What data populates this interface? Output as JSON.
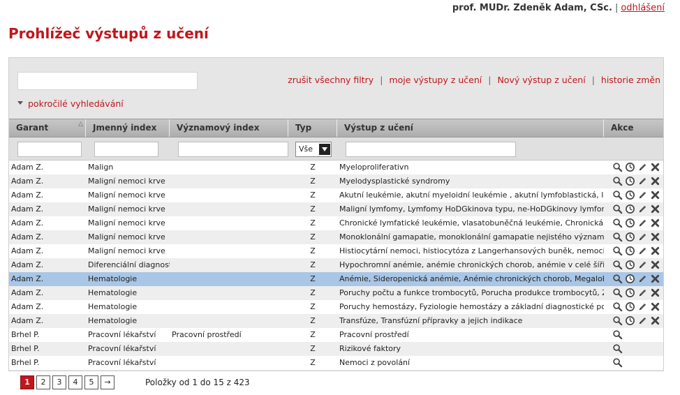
{
  "header": {
    "user_name": "prof. MUDr. Zdeněk Adam, CSc.",
    "separator": "|",
    "logout_label": "odhlášení"
  },
  "page": {
    "title": "Prohlížeč výstupů z učení"
  },
  "toolbar": {
    "search_value": "",
    "links": [
      "zrušit všechny filtry",
      "moje výstupy z učení",
      "Nový výstup z učení",
      "historie změn"
    ],
    "link_separator": "|",
    "advanced_search": "pokročilé vyhledávání"
  },
  "table": {
    "columns": [
      "Garant",
      "Jmenný index",
      "Významový index",
      "Typ",
      "Výstup z učení",
      "Akce"
    ],
    "sorted_column": "Garant",
    "type_filter": "Vše",
    "rows": [
      {
        "garant": "Adam Z.",
        "jmenny": "Malign",
        "vyznamovy": "",
        "typ": "Z",
        "vystup": "Myeloproliferativn",
        "actions": [
          "search",
          "history",
          "edit",
          "delete"
        ],
        "selected": false
      },
      {
        "garant": "Adam Z.",
        "jmenny": "Maligní nemoci krve",
        "vyznamovy": "",
        "typ": "Z",
        "vystup": "Myelodysplastické syndromy",
        "actions": [
          "search",
          "history",
          "edit",
          "delete"
        ],
        "selected": false
      },
      {
        "garant": "Adam Z.",
        "jmenny": "Maligní nemoci krve",
        "vyznamovy": "",
        "typ": "Z",
        "vystup": "Akutní leukémie, akutní myeloidní leukémie , akutní lymfoblastická, leukémie",
        "actions": [
          "search",
          "history",
          "edit",
          "delete"
        ],
        "selected": false
      },
      {
        "garant": "Adam Z.",
        "jmenny": "Maligní nemoci krve",
        "vyznamovy": "",
        "typ": "Z",
        "vystup": "Maligní lymfomy, Lymfomy HoDGkinova typu, ne-HoDGkinovy lymfomy",
        "actions": [
          "search",
          "history",
          "edit",
          "delete"
        ],
        "selected": false
      },
      {
        "garant": "Adam Z.",
        "jmenny": "Maligní nemoci krve",
        "vyznamovy": "",
        "typ": "Z",
        "vystup": "Chronické lymfatické leukémie, vlasatobuněčná leukémie, Chronická B-lymfocytární",
        "actions": [
          "search",
          "history",
          "edit",
          "delete"
        ],
        "selected": false
      },
      {
        "garant": "Adam Z.",
        "jmenny": "Maligní nemoci krve",
        "vyznamovy": "",
        "typ": "Z",
        "vystup": "Monoklonální gamapatie, monoklonální gamapatie nejistého významu (MGUS), myelom",
        "actions": [
          "search",
          "history",
          "edit",
          "delete"
        ],
        "selected": false
      },
      {
        "garant": "Adam Z.",
        "jmenny": "Maligní nemoci krve",
        "vyznamovy": "",
        "typ": "Z",
        "vystup": "Histiocytární nemoci, histiocytóza z Langerhansových buněk, nemoci ze skupiny",
        "actions": [
          "search",
          "history",
          "edit",
          "delete"
        ],
        "selected": false
      },
      {
        "garant": "Adam Z.",
        "jmenny": "Diferenciální diagnostiky",
        "vyznamovy": "",
        "typ": "Z",
        "vystup": "Hypochromní anémie, anémie chronických chorob, anémie v celé šíři, trombocytopenie",
        "actions": [
          "search",
          "history",
          "edit",
          "delete"
        ],
        "selected": false
      },
      {
        "garant": "Adam Z.",
        "jmenny": "Hematologie",
        "vyznamovy": "",
        "typ": "Z",
        "vystup": "Anémie, Sideropenická anémie, Anémie chronických chorob, Megaloblastové anémie",
        "actions": [
          "search",
          "history",
          "edit",
          "delete"
        ],
        "selected": true
      },
      {
        "garant": "Adam Z.",
        "jmenny": "Hematologie",
        "vyznamovy": "",
        "typ": "Z",
        "vystup": "Poruchy počtu a funkce trombocytů, Porucha produkce trombocytů, Zvýšená destrukce",
        "actions": [
          "search",
          "history",
          "edit",
          "delete"
        ],
        "selected": false
      },
      {
        "garant": "Adam Z.",
        "jmenny": "Hematologie",
        "vyznamovy": "",
        "typ": "Z",
        "vystup": "Poruchy hemostázy, Fyziologie hemostázy a základní diagnostické postupy, Vrozené",
        "actions": [
          "search",
          "history",
          "edit",
          "delete"
        ],
        "selected": false
      },
      {
        "garant": "Adam Z.",
        "jmenny": "Hematologie",
        "vyznamovy": "",
        "typ": "Z",
        "vystup": "Transfúze, Transfúzní přípravky a jejich indikace",
        "actions": [
          "search",
          "history",
          "edit",
          "delete"
        ],
        "selected": false
      },
      {
        "garant": "Brhel P.",
        "jmenny": "Pracovní lékařství",
        "vyznamovy": "Pracovní prostředí",
        "typ": "Z",
        "vystup": "Pracovní prostředí",
        "actions": [
          "search"
        ],
        "selected": false
      },
      {
        "garant": "Brhel P.",
        "jmenny": "Pracovní lékařství",
        "vyznamovy": "",
        "typ": "Z",
        "vystup": "Rizikové faktory",
        "actions": [
          "search"
        ],
        "selected": false
      },
      {
        "garant": "Brhel P.",
        "jmenny": "Pracovní lékařství",
        "vyznamovy": "",
        "typ": "Z",
        "vystup": "Nemoci z povolání",
        "actions": [
          "search"
        ],
        "selected": false
      }
    ]
  },
  "pagination": {
    "pages": [
      "1",
      "2",
      "3",
      "4",
      "5"
    ],
    "current": "1",
    "next_label": "→",
    "summary": "Položky od 1 do 15 z 423"
  },
  "colors": {
    "accent": "#c0161d",
    "selected_row": "#a9c6e6",
    "panel_bg": "#e6e6e6",
    "header_bg": "#b9b9b9"
  }
}
